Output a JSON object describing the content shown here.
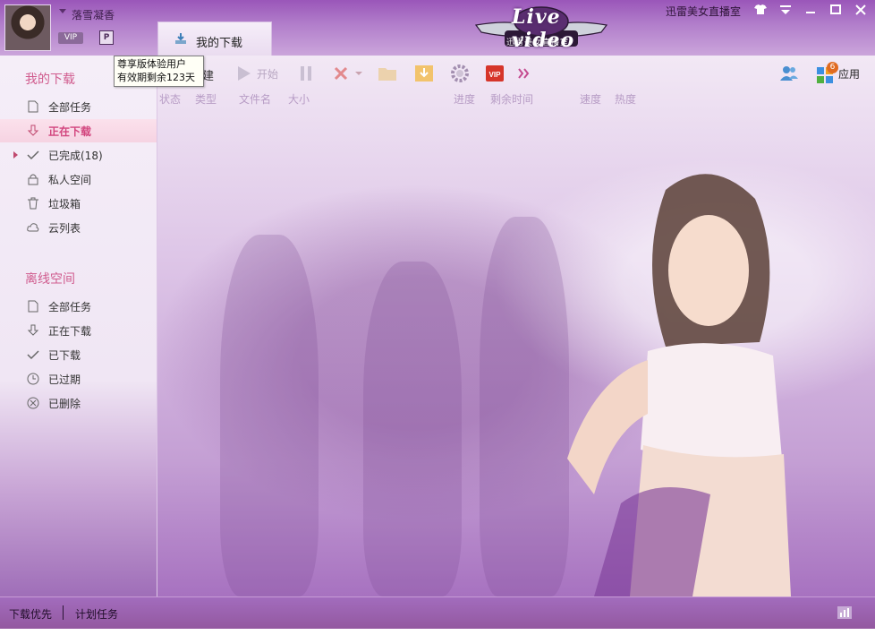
{
  "window": {
    "title": "迅雷美女直播室"
  },
  "user": {
    "name": "落雪凝香",
    "badge": "VIP"
  },
  "tabs": [
    {
      "label": "我的下载"
    }
  ],
  "logo": {
    "main": "Live video",
    "sub": "迅雷美女直播室"
  },
  "tooltip": {
    "line1": "尊享版体验用户",
    "line2": "有效期剩余123天"
  },
  "toolbar": {
    "new_label": "建",
    "start_label": "开始",
    "app_label": "应用",
    "app_badge": "6",
    "vip_label": "VIP"
  },
  "columns": [
    "状态",
    "类型",
    "文件名",
    "大小",
    "进度",
    "剩余时间",
    "速度",
    "热度"
  ],
  "sidebar": {
    "my_downloads_title": "我的下载",
    "my_downloads": [
      {
        "label": "全部任务",
        "icon": "file-icon"
      },
      {
        "label": "正在下载",
        "icon": "download-arrow-icon",
        "active": true
      },
      {
        "label": "已完成(18)",
        "icon": "check-icon"
      },
      {
        "label": "私人空间",
        "icon": "lock-icon"
      },
      {
        "label": "垃圾箱",
        "icon": "trash-icon"
      },
      {
        "label": "云列表",
        "icon": "cloud-icon"
      }
    ],
    "offline_title": "离线空间",
    "offline": [
      {
        "label": "全部任务",
        "icon": "file-icon"
      },
      {
        "label": "正在下载",
        "icon": "download-arrow-icon"
      },
      {
        "label": "已下载",
        "icon": "check-icon"
      },
      {
        "label": "已过期",
        "icon": "clock-icon"
      },
      {
        "label": "已删除",
        "icon": "deleted-circle-icon"
      }
    ]
  },
  "status": {
    "priority": "下载优先",
    "plan": "计划任务"
  },
  "colors": {
    "accent": "#d2457e",
    "brand": "#9a56b9"
  }
}
